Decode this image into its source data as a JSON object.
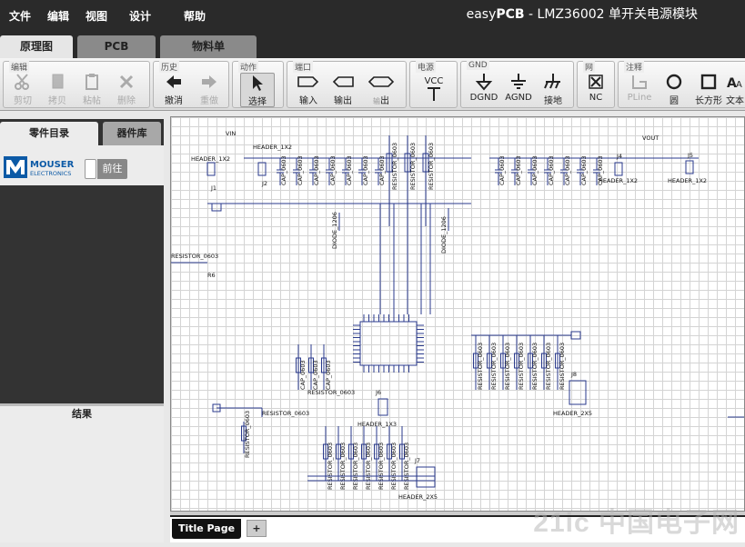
{
  "menu": {
    "items": [
      "文件",
      "编辑",
      "视图",
      "设计",
      "帮助"
    ],
    "app_title_prefix": "easy",
    "app_title_brand": "PCB",
    "app_title_suffix": " - LMZ36002 单开关电源模块"
  },
  "tabs": [
    "原理图",
    "PCB",
    "物料单"
  ],
  "toolbar": {
    "groups": {
      "edit": "编辑",
      "history": "历史",
      "action": "动作",
      "port": "端口",
      "power": "电源",
      "gnd": "GND",
      "net": "网",
      "annotation": "注释"
    },
    "buttons": {
      "cut": "剪切",
      "copy": "拷贝",
      "paste": "粘帖",
      "delete": "删除",
      "undo": "撤消",
      "redo": "重做",
      "select": "选择",
      "input": "输入",
      "output": "输出",
      "inout": "出",
      "inout_prefix": "输",
      "vcc": "VCC",
      "dgnd": "DGND",
      "agnd": "AGND",
      "ground": "接地",
      "nc": "NC",
      "pline": "PLine",
      "circle": "圆",
      "rect": "长方形",
      "text": "文本"
    }
  },
  "left_panel": {
    "tabs": [
      "零件目录",
      "器件库"
    ],
    "mouser_brand": "MOUSER",
    "mouser_sub": "ELECTRONICS",
    "go_button": "前往",
    "results_label": "结果"
  },
  "schematic": {
    "labels": [
      "HEADER_1X2",
      "HEADER_1X2",
      "HEADER_1X2",
      "HEADER_1X2",
      "HEADER_1X3",
      "HEADER_1X3",
      "HEADER_2X5",
      "HEADER_2X5",
      "CAP_0603",
      "CAP_0603",
      "CAP_0603",
      "CAP_0603",
      "CAP_0603",
      "CAP_1206",
      "CAP_1206",
      "RESISTOR_0603",
      "RESISTOR_0603",
      "RESISTOR_0603",
      "RESISTOR_0603",
      "RESISTOR_0603",
      "RESISTOR_0603",
      "DIODE_1206",
      "DIODE_1206",
      "J1",
      "J2",
      "J3",
      "J4",
      "J5",
      "J6",
      "J7",
      "J8",
      "R1",
      "R2",
      "R3",
      "R4",
      "R5",
      "R6",
      "R7",
      "R8",
      "R9",
      "R10",
      "R11",
      "R12",
      "R13",
      "R14",
      "R15",
      "R16",
      "R17",
      "R18",
      "R19",
      "R20",
      "R21",
      "C1",
      "C2",
      "C3",
      "C11",
      "C12",
      "C17",
      "D1",
      "D2",
      "VOUT",
      "VIN"
    ]
  },
  "page_tabs": {
    "title_page": "Title Page",
    "add": "+"
  },
  "watermark": "21ic 中国电子网"
}
